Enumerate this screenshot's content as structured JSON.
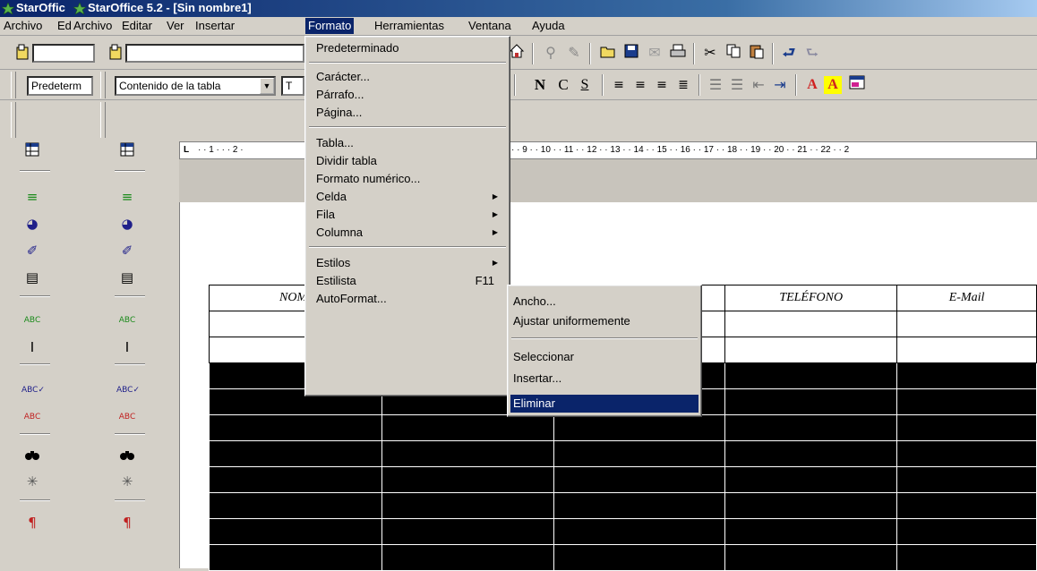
{
  "window": {
    "title_left": "StarOffic",
    "title": "StarOffice 5.2 - [Sin nombre1]"
  },
  "menubar": {
    "items": [
      {
        "label": "Archivo"
      },
      {
        "label": "Ed"
      },
      {
        "label": "Archivo"
      },
      {
        "label": "Editar"
      },
      {
        "label": "Ver"
      },
      {
        "label": "Insertar"
      },
      {
        "label": "Formato"
      },
      {
        "label": "Herramientas"
      },
      {
        "label": "Ventana"
      },
      {
        "label": "Ayuda"
      }
    ]
  },
  "toolbar": {
    "style_combo_left": "Predeterm",
    "style_combo": "Contenido de la tabla",
    "font_combo_partial": "T",
    "bold": "N",
    "italic": "C",
    "underline": "S",
    "font_color": "A",
    "highlight": "A"
  },
  "ruler": {
    "text": "· · 1 · · · 2 ·",
    "text_right": "· · 9 · · 10 · · 11 · · 12 · · 13 · · 14 · · 15 · · 16 · · 17 · · 18 · · 19 · · 20 · · 21 · · 22 · · 2"
  },
  "table": {
    "headers": [
      "NOMI",
      "",
      "",
      "TELÉFONO",
      "E-Mail"
    ]
  },
  "formato_menu": {
    "items": [
      {
        "label": "Predeterminado",
        "submenu": false,
        "shortcut": ""
      },
      {
        "label": "Carácter...",
        "submenu": false,
        "shortcut": ""
      },
      {
        "label": "Párrafo...",
        "submenu": false,
        "shortcut": ""
      },
      {
        "label": "Página...",
        "submenu": false,
        "shortcut": ""
      },
      {
        "label": "Tabla...",
        "submenu": false,
        "shortcut": ""
      },
      {
        "label": "Dividir tabla",
        "submenu": false,
        "shortcut": ""
      },
      {
        "label": "Formato numérico...",
        "submenu": false,
        "shortcut": ""
      },
      {
        "label": "Celda",
        "submenu": true,
        "shortcut": ""
      },
      {
        "label": "Fila",
        "submenu": true,
        "shortcut": ""
      },
      {
        "label": "Columna",
        "submenu": true,
        "shortcut": ""
      },
      {
        "label": "Estilos",
        "submenu": true,
        "shortcut": ""
      },
      {
        "label": "Estilista",
        "submenu": false,
        "shortcut": "F11"
      },
      {
        "label": "AutoFormat...",
        "submenu": false,
        "shortcut": ""
      }
    ]
  },
  "columna_submenu": {
    "items": [
      {
        "label": "Ancho...",
        "highlighted": false
      },
      {
        "label": "Ajustar uniformemente",
        "highlighted": false
      },
      {
        "label": "Seleccionar",
        "highlighted": false
      },
      {
        "label": "Insertar...",
        "highlighted": false
      },
      {
        "label": "Eliminar",
        "highlighted": true
      }
    ]
  },
  "colors": {
    "highlight": "#0a246a",
    "face": "#d4d0c8"
  }
}
